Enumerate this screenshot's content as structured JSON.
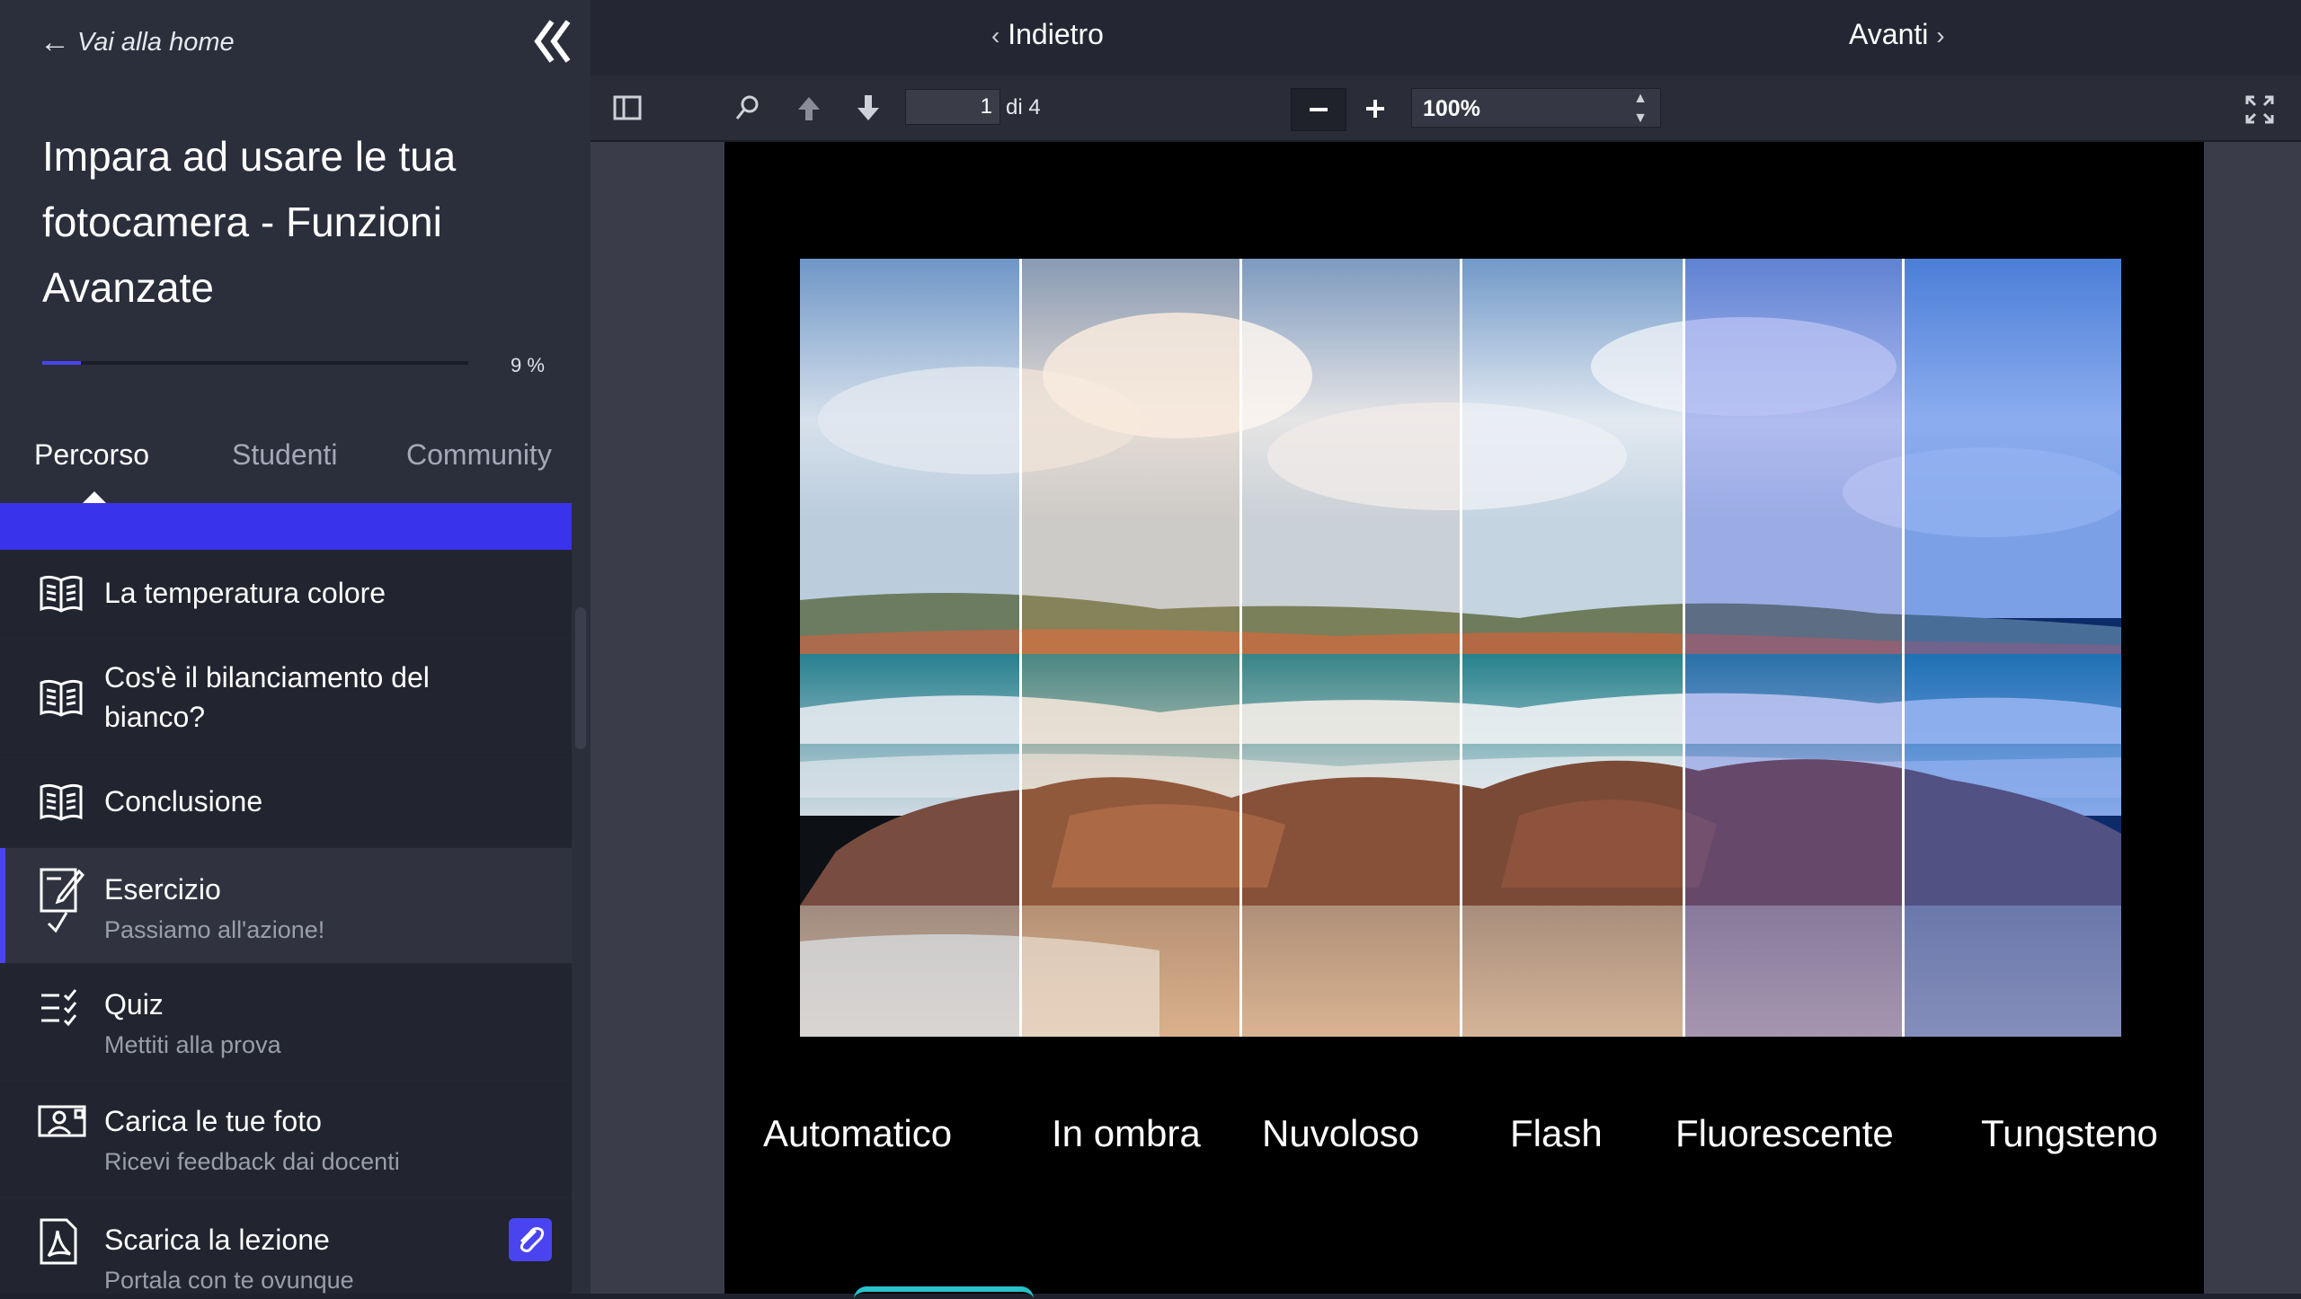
{
  "sidebar": {
    "back_label": "Vai alla home",
    "course_title": "Impara ad usare le tua fotocamera - Funzioni Avanzate",
    "progress_percent": 9,
    "progress_label": "9 %",
    "tabs": [
      {
        "label": "Percorso",
        "active": true
      },
      {
        "label": "Studenti",
        "active": false
      },
      {
        "label": "Community",
        "active": false
      }
    ],
    "items": [
      {
        "icon": "book-icon",
        "label": "La temperatura colore",
        "sub": ""
      },
      {
        "icon": "book-icon",
        "label": "Cos'è il bilanciamento del bianco?",
        "sub": ""
      },
      {
        "icon": "book-icon",
        "label": "Conclusione",
        "sub": ""
      },
      {
        "icon": "exercise-icon",
        "label": "Esercizio",
        "sub": "Passiamo all'azione!"
      },
      {
        "icon": "quiz-icon",
        "label": "Quiz",
        "sub": "Mettiti alla prova"
      },
      {
        "icon": "photo-upload-icon",
        "label": "Carica le tue foto",
        "sub": "Ricevi feedback dai docenti"
      },
      {
        "icon": "pdf-icon",
        "label": "Scarica la lezione",
        "sub": "Portala con te ovunque"
      }
    ]
  },
  "nav": {
    "back_label": "Indietro",
    "next_label": "Avanti"
  },
  "pdf_toolbar": {
    "page_current": "1",
    "page_of": "di 4",
    "zoom": "100%"
  },
  "document": {
    "captions": [
      "Automatico",
      "In ombra",
      "Nuvoloso",
      "Flash",
      "Fluorescente",
      "Tungsteno"
    ]
  },
  "colors": {
    "accent": "#4a44f0",
    "sidebar_bg": "#2b2e3b",
    "viewer_bg": "#3a3d49"
  }
}
